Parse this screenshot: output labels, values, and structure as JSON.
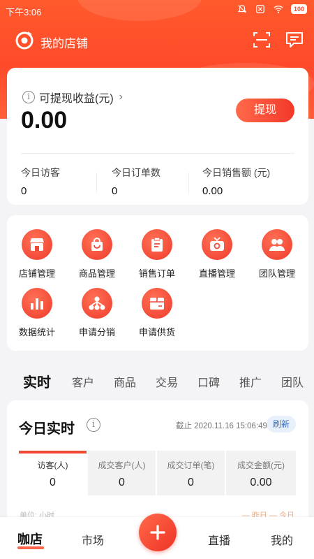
{
  "status_bar": {
    "time": "下午3:06",
    "battery": "100"
  },
  "header": {
    "title": "我的店铺"
  },
  "earnings": {
    "label": "可提现收益(元)",
    "amount": "0.00",
    "withdraw_label": "提现",
    "stats": [
      {
        "label": "今日访客",
        "value": "0"
      },
      {
        "label": "今日订单数",
        "value": "0"
      },
      {
        "label": "今日销售额 (元)",
        "value": "0.00"
      }
    ]
  },
  "functions": [
    {
      "label": "店铺管理",
      "icon": "store-icon"
    },
    {
      "label": "商品管理",
      "icon": "bag-icon"
    },
    {
      "label": "销售订单",
      "icon": "order-icon"
    },
    {
      "label": "直播管理",
      "icon": "tv-icon"
    },
    {
      "label": "团队管理",
      "icon": "team-icon"
    },
    {
      "label": "数据统计",
      "icon": "bar-chart-icon"
    },
    {
      "label": "申请分销",
      "icon": "network-icon"
    },
    {
      "label": "申请供货",
      "icon": "supply-box-icon"
    }
  ],
  "tabs": [
    "实时",
    "客户",
    "商品",
    "交易",
    "口碑",
    "推广",
    "团队"
  ],
  "realtime": {
    "title": "今日实时",
    "timestamp": "截止 2020.11.16 15:06:49",
    "refresh_label": "刷新",
    "metrics": [
      {
        "label": "访客(人)",
        "value": "0"
      },
      {
        "label": "成交客户(人)",
        "value": "0"
      },
      {
        "label": "成交订单(笔)",
        "value": "0"
      },
      {
        "label": "成交金额(元)",
        "value": "0.00"
      }
    ],
    "faded_left": "单位: 小时",
    "faded_right": "— 昨日  — 今日"
  },
  "bottom_nav": {
    "items": [
      "咖店",
      "市场",
      "直播",
      "我的"
    ]
  },
  "colors": {
    "brand": "#ff4a2a",
    "accent_blue": "#3a6fc0"
  }
}
